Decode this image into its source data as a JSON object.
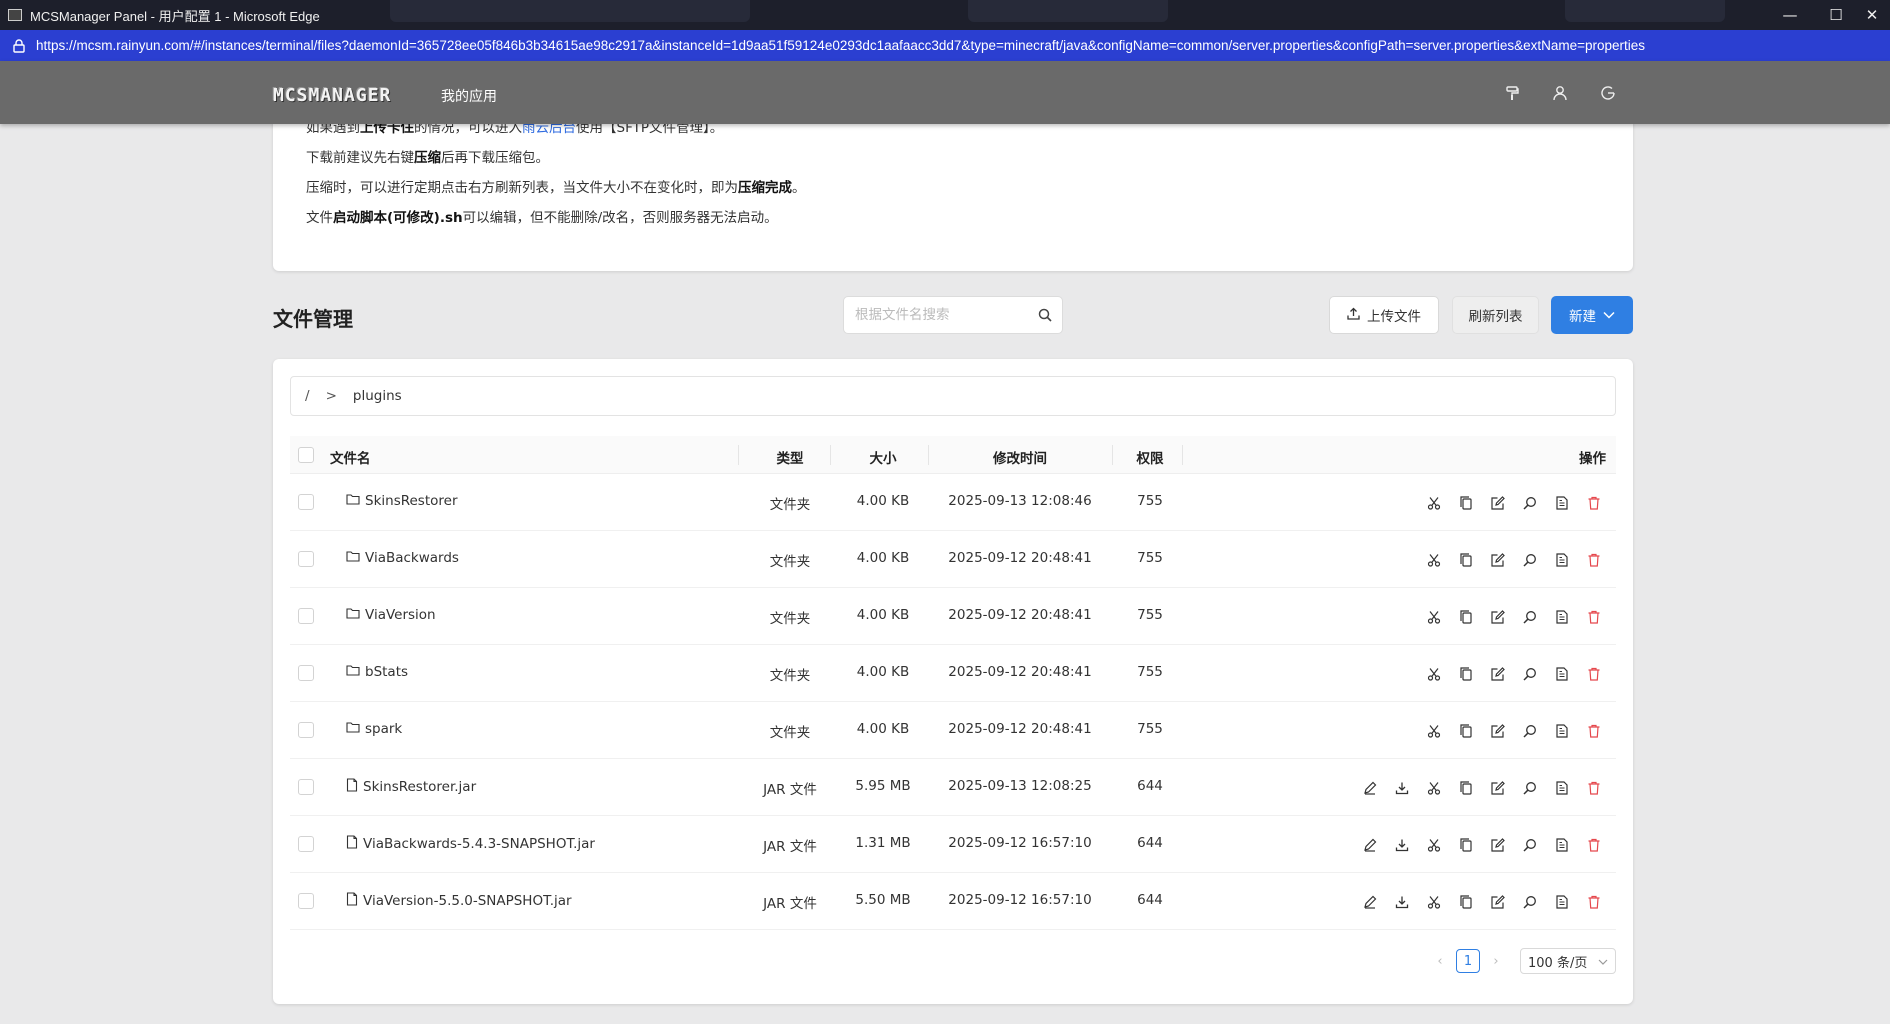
{
  "browser": {
    "window_title": "MCSManager Panel - 用户配置 1 - Microsoft Edge",
    "url": "https://mcsm.rainyun.com/#/instances/terminal/files?daemonId=365728ee05f846b3b34615ae98c2917a&instanceId=1d9aa51f59124e0293dc1aafaacc3dd7&type=minecraft/java&configName=common/server.properties&configPath=server.properties&extName=properties",
    "controls": {
      "minimize": "—",
      "maximize": "☐",
      "close": "✕"
    }
  },
  "header": {
    "logo_text": "MCSMANAGER",
    "nav_label": "我的应用",
    "icons": [
      "paint-roller-icon",
      "user-icon",
      "logout-icon"
    ]
  },
  "notice": {
    "line1": {
      "prefix": "如果遇到",
      "bold1": "上传卡住",
      "mid": "的情况，可以进入",
      "link": "雨云后台",
      "suffix": "使用【SFTP文件管理】。"
    },
    "line2": {
      "prefix": "下载前建议先右键",
      "bold": "压缩",
      "suffix": "后再下载压缩包。"
    },
    "line3": {
      "prefix": "压缩时，可以进行定期点击右方刷新列表，当文件大小不在变化时，即为",
      "bold": "压缩完成",
      "suffix": "。"
    },
    "line4": {
      "prefix": "文件",
      "bold": "启动脚本(可修改).sh",
      "suffix": "可以编辑，但不能删除/改名，否则服务器无法启动。"
    }
  },
  "file_manager": {
    "title": "文件管理",
    "search_placeholder": "根据文件名搜索",
    "upload_label": "上传文件",
    "refresh_label": "刷新列表",
    "new_label": "新建",
    "breadcrumb": {
      "root": "/",
      "separator": ">",
      "current": "plugins"
    },
    "columns": {
      "name": "文件名",
      "type": "类型",
      "size": "大小",
      "mtime": "修改时间",
      "perm": "权限",
      "actions": "操作"
    },
    "rows": [
      {
        "name": "SkinsRestorer",
        "type": "文件夹",
        "size": "4.00 KB",
        "mtime": "2025-09-13 12:08:46",
        "perm": "755"
      },
      {
        "name": "ViaBackwards",
        "type": "文件夹",
        "size": "4.00 KB",
        "mtime": "2025-09-12 20:48:41",
        "perm": "755"
      },
      {
        "name": "ViaVersion",
        "type": "文件夹",
        "size": "4.00 KB",
        "mtime": "2025-09-12 20:48:41",
        "perm": "755"
      },
      {
        "name": "bStats",
        "type": "文件夹",
        "size": "4.00 KB",
        "mtime": "2025-09-12 20:48:41",
        "perm": "755"
      },
      {
        "name": "spark",
        "type": "文件夹",
        "size": "4.00 KB",
        "mtime": "2025-09-12 20:48:41",
        "perm": "755"
      },
      {
        "name": "SkinsRestorer.jar",
        "type": "JAR 文件",
        "size": "5.95 MB",
        "mtime": "2025-09-13 12:08:25",
        "perm": "644"
      },
      {
        "name": "ViaBackwards-5.4.3-SNAPSHOT.jar",
        "type": "JAR 文件",
        "size": "1.31 MB",
        "mtime": "2025-09-12 16:57:10",
        "perm": "644"
      },
      {
        "name": "ViaVersion-5.5.0-SNAPSHOT.jar",
        "type": "JAR 文件",
        "size": "5.50 MB",
        "mtime": "2025-09-12 16:57:10",
        "perm": "644"
      }
    ],
    "pagination": {
      "current_page": "1",
      "page_size": "100 条/页"
    }
  },
  "colors": {
    "accent": "#2f7fe3",
    "danger": "#e5484d",
    "address_bar": "#2b3fd1",
    "header": "#6a6a6a"
  }
}
